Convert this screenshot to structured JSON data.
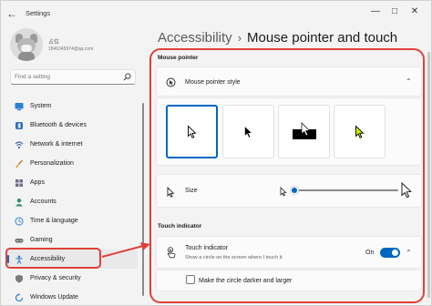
{
  "window": {
    "title": "Settings"
  },
  "colors": {
    "accent": "#0067c0",
    "annotation": "#e0403a",
    "cursor_yellow": "#c8f000"
  },
  "profile": {
    "name": "占位",
    "email": "1846345974@qq.com"
  },
  "search": {
    "placeholder": "Find a setting"
  },
  "sidebar": {
    "items": [
      {
        "label": "System",
        "icon": "monitor-icon"
      },
      {
        "label": "Bluetooth & devices",
        "icon": "bluetooth-icon"
      },
      {
        "label": "Network & internet",
        "icon": "wifi-icon"
      },
      {
        "label": "Personalization",
        "icon": "brush-icon"
      },
      {
        "label": "Apps",
        "icon": "apps-icon"
      },
      {
        "label": "Accounts",
        "icon": "person-icon"
      },
      {
        "label": "Time & language",
        "icon": "globe-clock-icon"
      },
      {
        "label": "Gaming",
        "icon": "controller-icon"
      },
      {
        "label": "Accessibility",
        "icon": "accessibility-icon",
        "selected": true
      },
      {
        "label": "Privacy & security",
        "icon": "shield-icon"
      },
      {
        "label": "Windows Update",
        "icon": "update-icon"
      }
    ]
  },
  "breadcrumb": {
    "parent": "Accessibility",
    "separator": "›",
    "current": "Mouse pointer and touch"
  },
  "mouse_pointer": {
    "section_label": "Mouse pointer",
    "style_card": {
      "label": "Mouse pointer style",
      "icon": "pointer-style-icon",
      "expanded": true
    },
    "style_options": [
      "white",
      "black",
      "inverted",
      "custom"
    ],
    "selected_style": "white",
    "size": {
      "label": "Size",
      "value_fraction": 0.0
    }
  },
  "touch_indicator": {
    "section_label": "Touch indicator",
    "label": "Touch indicator",
    "description": "Show a circle on the screen where I touch it",
    "state_label": "On",
    "enabled": true,
    "option": {
      "label": "Make the circle darker and larger",
      "checked": false
    }
  }
}
